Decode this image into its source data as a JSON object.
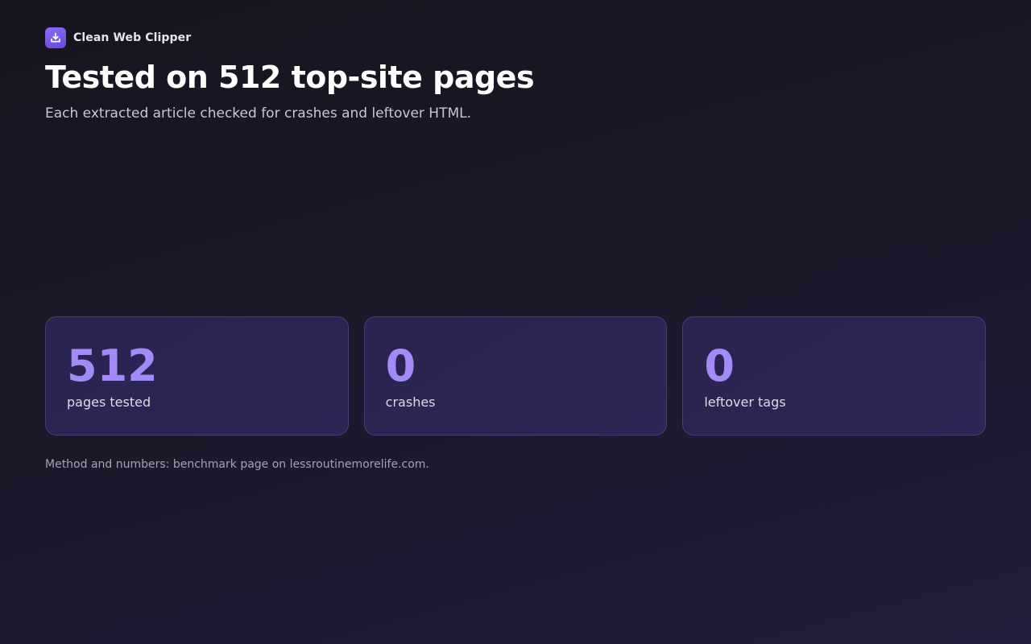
{
  "brand": {
    "name": "Clean Web Clipper",
    "icon": "download-tray-icon",
    "accent": "#7b5af0"
  },
  "hero": {
    "headline": "Tested on 512 top-site pages",
    "subhead": "Each extracted article checked for crashes and leftover HTML."
  },
  "stats": [
    {
      "value": "512",
      "label": "pages tested"
    },
    {
      "value": "0",
      "label": "crashes"
    },
    {
      "value": "0",
      "label": "leftover tags"
    }
  ],
  "footnote": "Method and numbers: benchmark page on lessroutinemorelife.com.",
  "colors": {
    "stat_value": "#a38bf7",
    "card_bg": "#2a2450",
    "card_border": "#46407a",
    "background": "#1b1828"
  }
}
